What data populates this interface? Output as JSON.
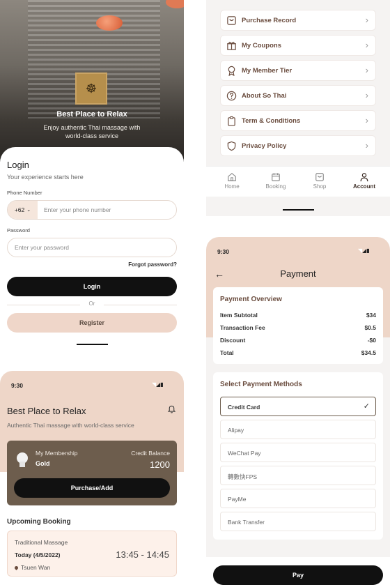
{
  "login": {
    "hero_title": "Best Place to Relax",
    "hero_subtitle": "Enjoy authentic Thai massage with world-class service",
    "title": "Login",
    "subtitle": "Your experience starts here",
    "phone_label": "Phone Number",
    "country_code": "+62",
    "phone_placeholder": "Enter your phone number",
    "password_label": "Password",
    "password_placeholder": "Enter your password",
    "forgot_password": "Forgot password?",
    "login_button": "Login",
    "or_text": "Or",
    "register_button": "Register"
  },
  "account": {
    "menu": [
      {
        "label": "Purchase Record",
        "icon": "bag-icon"
      },
      {
        "label": "My Coupons",
        "icon": "gift-icon"
      },
      {
        "label": "My Member Tier",
        "icon": "ribbon-icon"
      },
      {
        "label": "About So Thai",
        "icon": "question-icon"
      },
      {
        "label": "Term & Conditions",
        "icon": "clipboard-icon"
      },
      {
        "label": "Privacy Policy",
        "icon": "shield-icon"
      }
    ],
    "tabs": [
      {
        "label": "Home",
        "icon": "home-icon"
      },
      {
        "label": "Booking",
        "icon": "calendar-icon"
      },
      {
        "label": "Shop",
        "icon": "bag-icon"
      },
      {
        "label": "Account",
        "icon": "user-icon",
        "active": true
      }
    ]
  },
  "home": {
    "time": "9:30",
    "title": "Best Place to Relax",
    "subtitle": "Authentic Thai massage with world-class service",
    "membership_label": "My Membership",
    "tier": "Gold",
    "credit_label": "Credit Balance",
    "credit_balance": "1200",
    "purchase_button": "Purchase/Add",
    "upcoming_title": "Upcoming Booking",
    "booking": {
      "service": "Traditional Massage",
      "date": "Today (4/5/2022)",
      "time": "13:45 - 14:45",
      "location": "Tsuen Wan"
    }
  },
  "payment": {
    "time": "9:30",
    "title": "Payment",
    "overview_title": "Payment Overview",
    "overview": [
      {
        "label": "Item Subtotal",
        "value": "$34"
      },
      {
        "label": "Transaction Fee",
        "value": "$0.5"
      },
      {
        "label": "Discount",
        "value": "-$0"
      },
      {
        "label": "Total",
        "value": "$34.5"
      }
    ],
    "methods_title": "Select Payment Methods",
    "methods": [
      "Credit Card",
      "Alipay",
      "WeChat Pay",
      "轉數快FPS",
      "PayMe",
      "Bank Transfer"
    ],
    "selected_method": "Credit Card",
    "pay_button": "Pay"
  },
  "colors": {
    "peach": "#eed6c8",
    "brown": "#6d5d4d",
    "accent_text": "#6a4c3e",
    "dark": "#111111"
  }
}
